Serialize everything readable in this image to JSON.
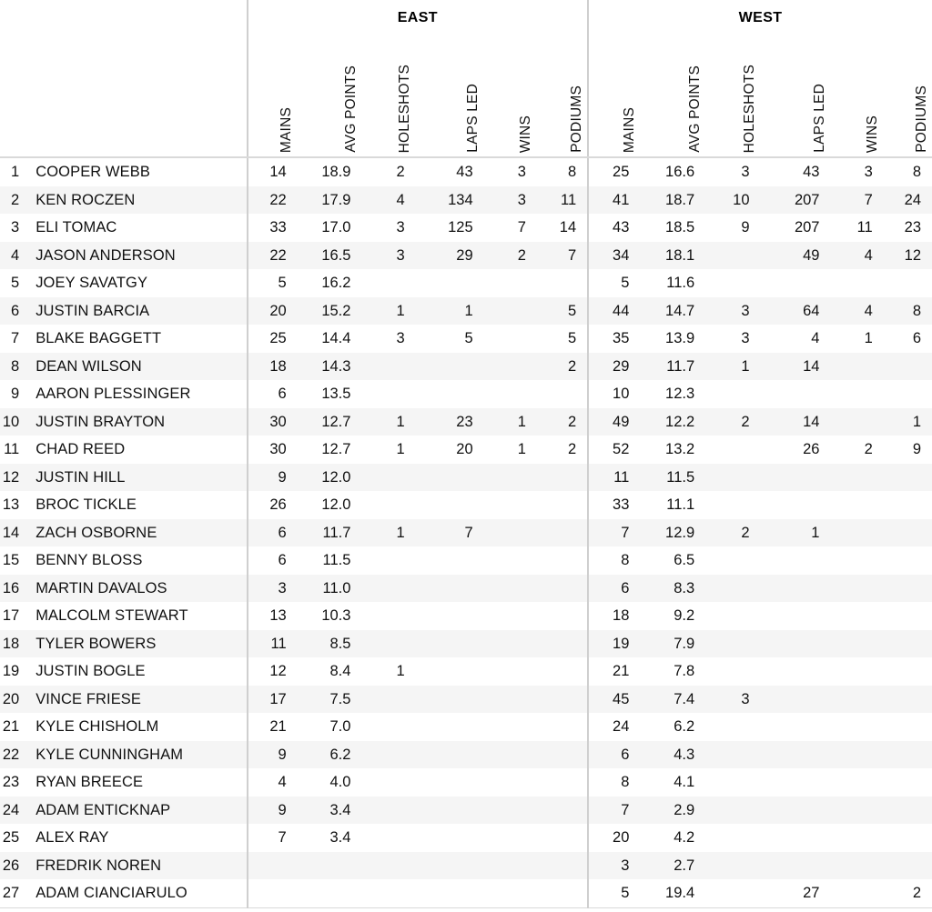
{
  "table": {
    "groups": [
      {
        "name": "east-group-header",
        "label": "EAST"
      },
      {
        "name": "west-group-header",
        "label": "WEST"
      }
    ],
    "stat_columns": [
      "MAINS",
      "AVG POINTS",
      "HOLESHOTS",
      "LAPS LED",
      "WINS",
      "PODIUMS"
    ],
    "headers": {
      "east": [
        "MAINS",
        "AVG POINTS",
        "HOLESHOTS",
        "LAPS LED",
        "WINS",
        "PODIUMS"
      ],
      "west": [
        "MAINS",
        "AVG POINTS",
        "HOLESHOTS",
        "LAPS LED",
        "WINS",
        "PODIUMS"
      ]
    },
    "rows": [
      {
        "pos": "1",
        "rider": "COOPER WEBB",
        "east": [
          "14",
          "18.9",
          "2",
          "43",
          "3",
          "8"
        ],
        "west": [
          "25",
          "16.6",
          "3",
          "43",
          "3",
          "8"
        ]
      },
      {
        "pos": "2",
        "rider": "KEN ROCZEN",
        "east": [
          "22",
          "17.9",
          "4",
          "134",
          "3",
          "11"
        ],
        "west": [
          "41",
          "18.7",
          "10",
          "207",
          "7",
          "24"
        ]
      },
      {
        "pos": "3",
        "rider": "ELI TOMAC",
        "east": [
          "33",
          "17.0",
          "3",
          "125",
          "7",
          "14"
        ],
        "west": [
          "43",
          "18.5",
          "9",
          "207",
          "11",
          "23"
        ]
      },
      {
        "pos": "4",
        "rider": "JASON ANDERSON",
        "east": [
          "22",
          "16.5",
          "3",
          "29",
          "2",
          "7"
        ],
        "west": [
          "34",
          "18.1",
          "",
          "49",
          "4",
          "12"
        ]
      },
      {
        "pos": "5",
        "rider": "JOEY SAVATGY",
        "east": [
          "5",
          "16.2",
          "",
          "",
          "",
          ""
        ],
        "west": [
          "5",
          "11.6",
          "",
          "",
          "",
          ""
        ]
      },
      {
        "pos": "6",
        "rider": "JUSTIN BARCIA",
        "east": [
          "20",
          "15.2",
          "1",
          "1",
          "",
          "5"
        ],
        "west": [
          "44",
          "14.7",
          "3",
          "64",
          "4",
          "8"
        ]
      },
      {
        "pos": "7",
        "rider": "BLAKE BAGGETT",
        "east": [
          "25",
          "14.4",
          "3",
          "5",
          "",
          "5"
        ],
        "west": [
          "35",
          "13.9",
          "3",
          "4",
          "1",
          "6"
        ]
      },
      {
        "pos": "8",
        "rider": "DEAN WILSON",
        "east": [
          "18",
          "14.3",
          "",
          "",
          "",
          "2"
        ],
        "west": [
          "29",
          "11.7",
          "1",
          "14",
          "",
          ""
        ]
      },
      {
        "pos": "9",
        "rider": "AARON PLESSINGER",
        "east": [
          "6",
          "13.5",
          "",
          "",
          "",
          ""
        ],
        "west": [
          "10",
          "12.3",
          "",
          "",
          "",
          ""
        ]
      },
      {
        "pos": "10",
        "rider": "JUSTIN BRAYTON",
        "east": [
          "30",
          "12.7",
          "1",
          "23",
          "1",
          "2"
        ],
        "west": [
          "49",
          "12.2",
          "2",
          "14",
          "",
          "1"
        ]
      },
      {
        "pos": "11",
        "rider": "CHAD REED",
        "east": [
          "30",
          "12.7",
          "1",
          "20",
          "1",
          "2"
        ],
        "west": [
          "52",
          "13.2",
          "",
          "26",
          "2",
          "9"
        ]
      },
      {
        "pos": "12",
        "rider": "JUSTIN HILL",
        "east": [
          "9",
          "12.0",
          "",
          "",
          "",
          ""
        ],
        "west": [
          "11",
          "11.5",
          "",
          "",
          "",
          ""
        ]
      },
      {
        "pos": "13",
        "rider": "BROC TICKLE",
        "east": [
          "26",
          "12.0",
          "",
          "",
          "",
          ""
        ],
        "west": [
          "33",
          "11.1",
          "",
          "",
          "",
          ""
        ]
      },
      {
        "pos": "14",
        "rider": "ZACH OSBORNE",
        "east": [
          "6",
          "11.7",
          "1",
          "7",
          "",
          ""
        ],
        "west": [
          "7",
          "12.9",
          "2",
          "1",
          "",
          ""
        ]
      },
      {
        "pos": "15",
        "rider": "BENNY BLOSS",
        "east": [
          "6",
          "11.5",
          "",
          "",
          "",
          ""
        ],
        "west": [
          "8",
          "6.5",
          "",
          "",
          "",
          ""
        ]
      },
      {
        "pos": "16",
        "rider": "MARTIN DAVALOS",
        "east": [
          "3",
          "11.0",
          "",
          "",
          "",
          ""
        ],
        "west": [
          "6",
          "8.3",
          "",
          "",
          "",
          ""
        ]
      },
      {
        "pos": "17",
        "rider": "MALCOLM STEWART",
        "east": [
          "13",
          "10.3",
          "",
          "",
          "",
          ""
        ],
        "west": [
          "18",
          "9.2",
          "",
          "",
          "",
          ""
        ]
      },
      {
        "pos": "18",
        "rider": "TYLER BOWERS",
        "east": [
          "11",
          "8.5",
          "",
          "",
          "",
          ""
        ],
        "west": [
          "19",
          "7.9",
          "",
          "",
          "",
          ""
        ]
      },
      {
        "pos": "19",
        "rider": "JUSTIN BOGLE",
        "east": [
          "12",
          "8.4",
          "1",
          "",
          "",
          ""
        ],
        "west": [
          "21",
          "7.8",
          "",
          "",
          "",
          ""
        ]
      },
      {
        "pos": "20",
        "rider": "VINCE FRIESE",
        "east": [
          "17",
          "7.5",
          "",
          "",
          "",
          ""
        ],
        "west": [
          "45",
          "7.4",
          "3",
          "",
          "",
          ""
        ]
      },
      {
        "pos": "21",
        "rider": "KYLE CHISHOLM",
        "east": [
          "21",
          "7.0",
          "",
          "",
          "",
          ""
        ],
        "west": [
          "24",
          "6.2",
          "",
          "",
          "",
          ""
        ]
      },
      {
        "pos": "22",
        "rider": "KYLE CUNNINGHAM",
        "east": [
          "9",
          "6.2",
          "",
          "",
          "",
          ""
        ],
        "west": [
          "6",
          "4.3",
          "",
          "",
          "",
          ""
        ]
      },
      {
        "pos": "23",
        "rider": "RYAN BREECE",
        "east": [
          "4",
          "4.0",
          "",
          "",
          "",
          ""
        ],
        "west": [
          "8",
          "4.1",
          "",
          "",
          "",
          ""
        ]
      },
      {
        "pos": "24",
        "rider": "ADAM ENTICKNAP",
        "east": [
          "9",
          "3.4",
          "",
          "",
          "",
          ""
        ],
        "west": [
          "7",
          "2.9",
          "",
          "",
          "",
          ""
        ]
      },
      {
        "pos": "25",
        "rider": "ALEX RAY",
        "east": [
          "7",
          "3.4",
          "",
          "",
          "",
          ""
        ],
        "west": [
          "20",
          "4.2",
          "",
          "",
          "",
          ""
        ]
      },
      {
        "pos": "26",
        "rider": "FREDRIK NOREN",
        "east": [
          "",
          "",
          "",
          "",
          "",
          ""
        ],
        "west": [
          "3",
          "2.7",
          "",
          "",
          "",
          ""
        ]
      },
      {
        "pos": "27",
        "rider": "ADAM CIANCIARULO",
        "east": [
          "",
          "",
          "",
          "",
          "",
          ""
        ],
        "west": [
          "5",
          "19.4",
          "",
          "27",
          "",
          "2"
        ]
      }
    ]
  },
  "style": {
    "stripe_color": "#f5f5f5",
    "divider_color": "#cfcfcf",
    "text_color": "#111111"
  }
}
